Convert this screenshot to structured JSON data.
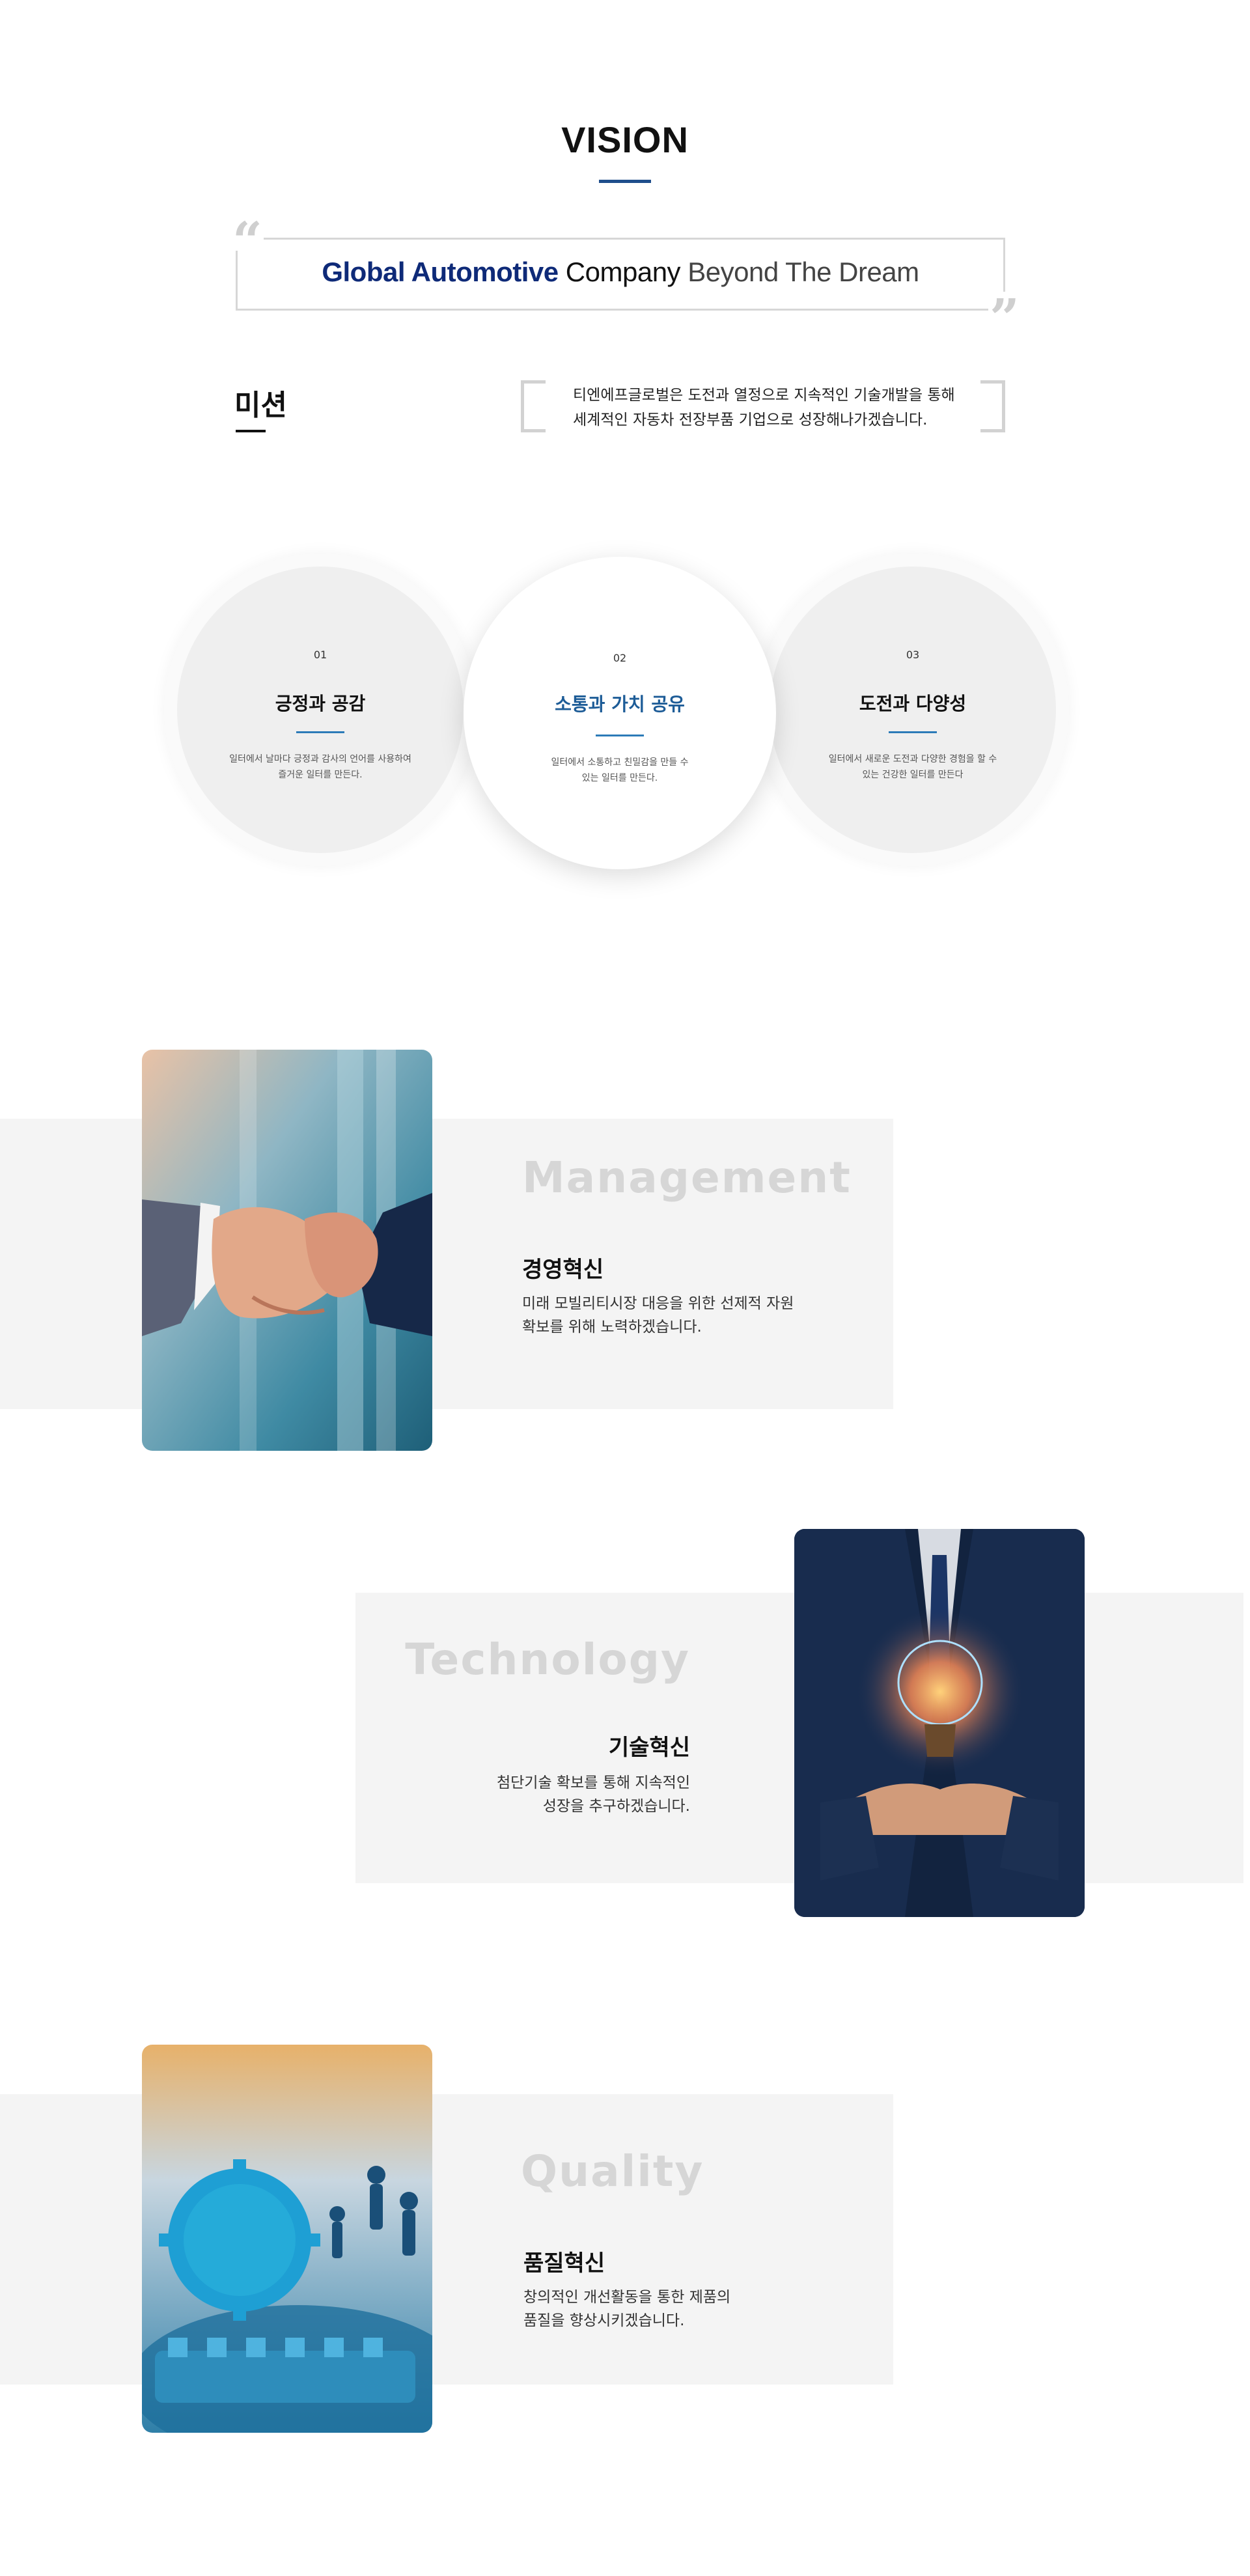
{
  "vision": {
    "title": "VISION",
    "slogan_part1": "Global Automotive",
    "slogan_part2": " Company",
    "slogan_part3": " Beyond The Dream",
    "quote_open": "“",
    "quote_close": "”"
  },
  "mission": {
    "title": "미션",
    "line1": "티엔에프글로벌은 도전과 열정으로 지속적인 기술개발을 통해",
    "line2": "세계적인 자동차 전장부품 기업으로 성장해나가겠습니다."
  },
  "values": [
    {
      "num": "01",
      "title": "긍정과 공감",
      "desc1": "일터에서 날마다 긍정과 감사의 언어를 사용하여",
      "desc2": "즐거운 일터를 만든다."
    },
    {
      "num": "02",
      "title": "소통과 가치 공유",
      "desc1": "일터에서 소통하고 친밀감을 만들 수",
      "desc2": "있는 일터를 만든다."
    },
    {
      "num": "03",
      "title": "도전과 다양성",
      "desc1": "일터에서 새로운 도전과 다양한 경험을 할 수",
      "desc2": "있는 건강한 일터를 만든다"
    }
  ],
  "features": [
    {
      "en": "Management",
      "ko": "경영혁신",
      "desc1": "미래 모빌리티시장 대응을 위한 선제적 자원",
      "desc2": "확보를 위해 노력하겠습니다.",
      "image": "handshake-photo"
    },
    {
      "en": "Technology",
      "ko": "기술혁신",
      "desc1": "첨단기술 확보를 통해 지속적인",
      "desc2": "성장을 추구하겠습니다.",
      "image": "lightbulb-photo"
    },
    {
      "en": "Quality",
      "ko": "품질혁신",
      "desc1": "창의적인 개선활동을 통한 제품의",
      "desc2": "품질을 향상시키겠습니다.",
      "image": "gears-photo"
    }
  ],
  "colors": {
    "brand_navy": "#0e2a78",
    "accent_blue": "#1d5c97",
    "band_gray": "#f4f4f4"
  }
}
